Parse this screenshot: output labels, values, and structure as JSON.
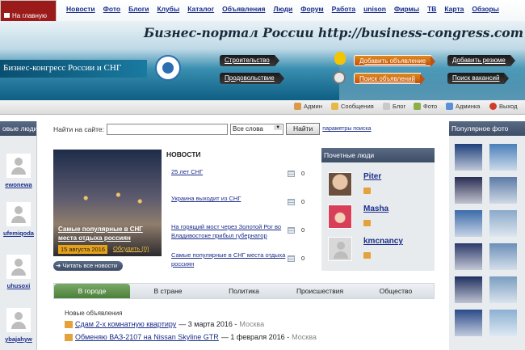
{
  "topnav": {
    "home_label": "На главную",
    "items": [
      "Новости",
      "Фото",
      "Блоги",
      "Клубы",
      "Каталог",
      "Объявления",
      "Люди",
      "Форум",
      "Работа",
      "unison",
      "Фирмы",
      "ТВ",
      "Карта",
      "Обзоры"
    ]
  },
  "banner": {
    "slogan": "Бизнес-портал России http://business-congress.com",
    "site_name": "Бизнес-конгресс России и СНГ",
    "cat_links": [
      "Строительство",
      "Продовольствие"
    ],
    "action_links": [
      "Добавить объявление",
      "Поиск объявлений"
    ],
    "right_links": [
      "Добавить резюме",
      "Поиск вакансий"
    ]
  },
  "toolbar": [
    "Админ",
    "Сообщения",
    "Блог",
    "Фото",
    "Админка",
    "Выход"
  ],
  "left": {
    "title": "овые люди",
    "users": [
      "ewonewa",
      "ufemiqoda",
      "uhusoxi",
      "ybajahyw"
    ]
  },
  "search": {
    "label": "Найти на сайте:",
    "value": "",
    "select_value": "Все слова",
    "button": "Найти",
    "params_link": "параметры поиска"
  },
  "news": {
    "title": "НОВОСТИ",
    "feature_caption": "Самые популярные в СНГ места отдыха россиян",
    "feature_date": "15 августа 2016",
    "feature_discuss": "Обсудить (0)",
    "read_all": "Читать все новости",
    "items": [
      {
        "text": "25 лет СНГ",
        "count": "0"
      },
      {
        "text": "Украина выходит из СНГ",
        "count": "0"
      },
      {
        "text": "На горящий мост через Золотой Рог во Владивостоке прибыл губернатор Приморья",
        "count": "0"
      },
      {
        "text": "Самые популярные в СНГ места отдыха россиян",
        "count": "0"
      }
    ]
  },
  "people": {
    "title": "Почетные люди",
    "list": [
      "Piter",
      "Masha",
      "kmcnancy"
    ]
  },
  "tabs": [
    "В городе",
    "В стране",
    "Политика",
    "Происшествия",
    "Общество"
  ],
  "ads": {
    "heading": "Новые объявления",
    "items": [
      {
        "title": "Сдам 2-х комнатную квартиру",
        "date": "— 3 марта 2016 -",
        "city": "Москва"
      },
      {
        "title": "Обменяю ВАЗ-2107 на Nissan Skyline GTR",
        "date": "— 1 февраля 2016 -",
        "city": "Москва"
      }
    ]
  },
  "right": {
    "title": "Популярное фото",
    "thumb_colors": [
      "#1e3f7a",
      "#4a7fb8",
      "#2a2d55",
      "#5b7aa6",
      "#3b6aa8",
      "#8aa9c9",
      "#2c3a6a",
      "#6b8fb8",
      "#1f2f5f",
      "#7b9dc0",
      "#2a4a88",
      "#8cb0d2"
    ]
  }
}
